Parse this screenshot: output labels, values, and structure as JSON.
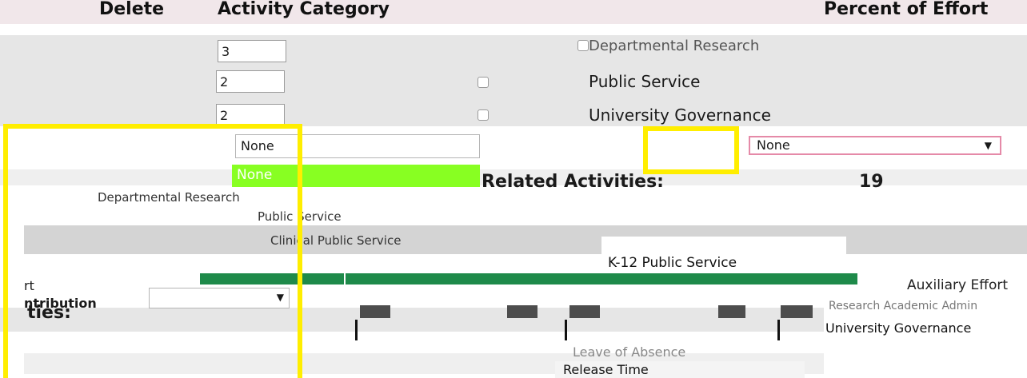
{
  "header": {
    "delete_label": "Delete",
    "activity_category_label": "Activity Category",
    "percent_effort_label": "Percent of Effort"
  },
  "rows": [
    {
      "value": "3",
      "category": "Departmental Research"
    },
    {
      "value": "2",
      "category": "Public Service"
    },
    {
      "value": "2",
      "category": "University Governance"
    }
  ],
  "dropdown_left": {
    "selected": "None",
    "highlighted_option": "None",
    "options": [
      "Departmental Research",
      "Public Service",
      "Clinical Public Service"
    ]
  },
  "dropdown_right": {
    "selected": "None",
    "options": [
      "K-12 Public Service",
      "Auxiliary Effort",
      "Research Academic Admin",
      "University Governance",
      "Leave of Absence",
      "Release Time"
    ]
  },
  "related_activities_label": "Related Activities:",
  "total_value": "19",
  "bottom": {
    "activities_label": "ties:",
    "part_label": "rt",
    "distribution_label": "ntribution"
  },
  "colors": {
    "highlight_yellow": "#ffee00",
    "option_green": "#88ff22",
    "bar_green": "#1e8a4a",
    "select_border_pink": "#e58aa8"
  }
}
